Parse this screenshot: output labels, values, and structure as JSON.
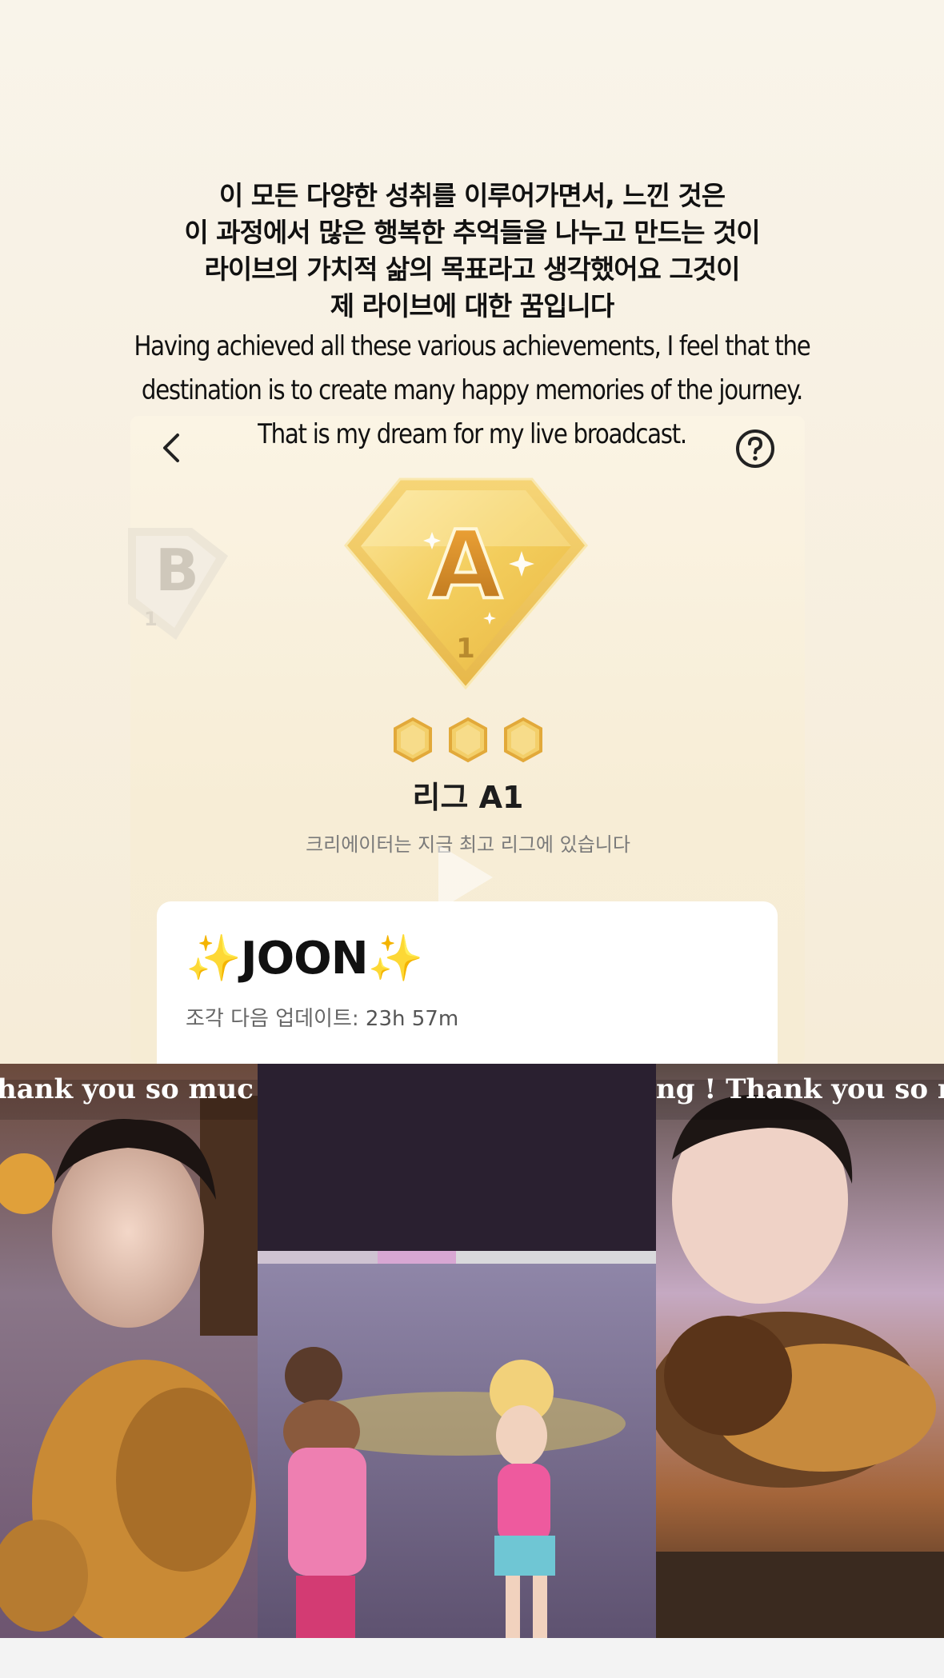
{
  "caption": {
    "korean_lines": [
      "이 모든 다양한 성취를 이루어가면서, 느낀 것은",
      "이 과정에서 많은 행복한 추억들을 나누고 만드는 것이",
      "라이브의 가치적 삶의 목표라고 생각했어요 그것이",
      "제 라이브에 대한 꿈입니다"
    ],
    "english_lines": [
      "Having achieved all these various achievements, I feel that the",
      "destination is to create many happy memories of the journey.",
      "That is my dream for my live broadcast."
    ]
  },
  "league": {
    "prev_badge_letter": "B",
    "prev_badge_level": "1",
    "badge_letter": "A",
    "badge_level": "1",
    "title": "리그 A1",
    "subtitle": "크리에이터는 지금 최고 리그에 있습니다",
    "pieces_filled": 3,
    "pieces_total": 3
  },
  "creator": {
    "name": "✨JOON✨",
    "next_update_label": "조각 다음 업데이트:",
    "next_update_value": "23h 57m"
  },
  "photos": {
    "left_overlay": "hank you so muc",
    "right_overlay": "ng ! Thank you so much"
  },
  "icons": {
    "back": "chevron-left-icon",
    "help": "question-circle-icon",
    "play": "play-icon"
  },
  "colors": {
    "gold": "#f0c24d",
    "gold_dark": "#c99a2c",
    "background": "#f8f2e6"
  }
}
